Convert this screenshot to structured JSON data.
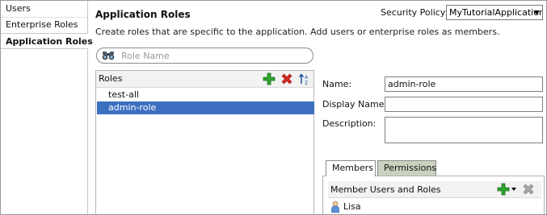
{
  "nav": {
    "items": [
      "Users",
      "Enterprise Roles",
      "Application Roles"
    ]
  },
  "header": {
    "title": "Application Roles",
    "description": "Create roles that are specific to the application.  Add users or enterprise roles as members.",
    "policy_label": "Security Policy:",
    "policy_value": "MyTutorialApplication"
  },
  "search": {
    "placeholder": "Role Name"
  },
  "roles": {
    "header": "Roles",
    "items": [
      "test-all",
      "admin-role"
    ],
    "selected_index": 1
  },
  "form": {
    "name_label": "Name:",
    "name_value": "admin-role",
    "display_name_label": "Display Name:",
    "display_name_value": "",
    "description_label": "Description:",
    "description_value": ""
  },
  "members": {
    "tabs": [
      "Members",
      "Permissions"
    ],
    "active_tab": "Members",
    "header": "Member Users and Roles",
    "items": [
      "Lisa"
    ]
  },
  "colors": {
    "selection": "#3c6fc0",
    "add_green": "#2ea52e",
    "delete_red": "#d42b1f"
  }
}
